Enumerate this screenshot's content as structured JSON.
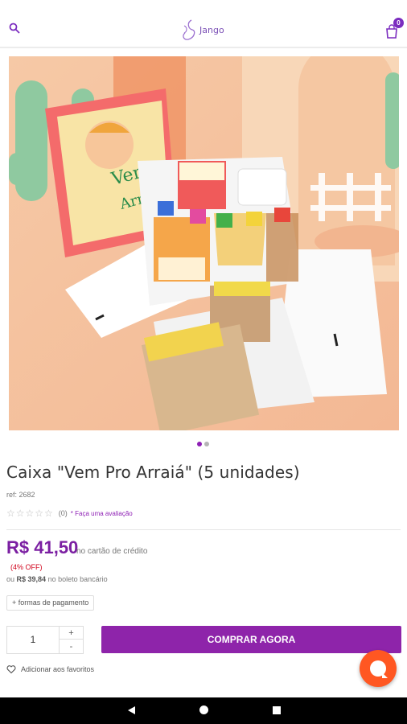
{
  "header": {
    "logo_text": "Jango",
    "cart_count": "0"
  },
  "colors": {
    "brand_purple": "#8e24aa",
    "price_purple": "#7b1fa2",
    "discount_red": "#d0021b",
    "chat_orange": "#ff5722"
  },
  "gallery": {
    "image_count": 2,
    "active_index": 0
  },
  "product": {
    "title": "Caixa \"Vem Pro Arraiá\" (5 unidades)",
    "ref": "ref: 2682",
    "rating": {
      "stars": "☆☆☆☆☆",
      "count": "(0)",
      "review_link": "* Faça uma avaliação"
    },
    "price": "R$ 41,50",
    "price_note": "no cartão de crédito",
    "discount": "(4% OFF)",
    "boleto_prefix": "ou",
    "boleto_price": "R$ 39,84",
    "boleto_suffix": "no boleto bancário",
    "payments_button": "+ formas de pagamento"
  },
  "purchase": {
    "quantity": "1",
    "plus": "+",
    "minus": "-",
    "buy_button": "COMPRAR AGORA",
    "favorite": "Adicionar aos favoritos"
  }
}
